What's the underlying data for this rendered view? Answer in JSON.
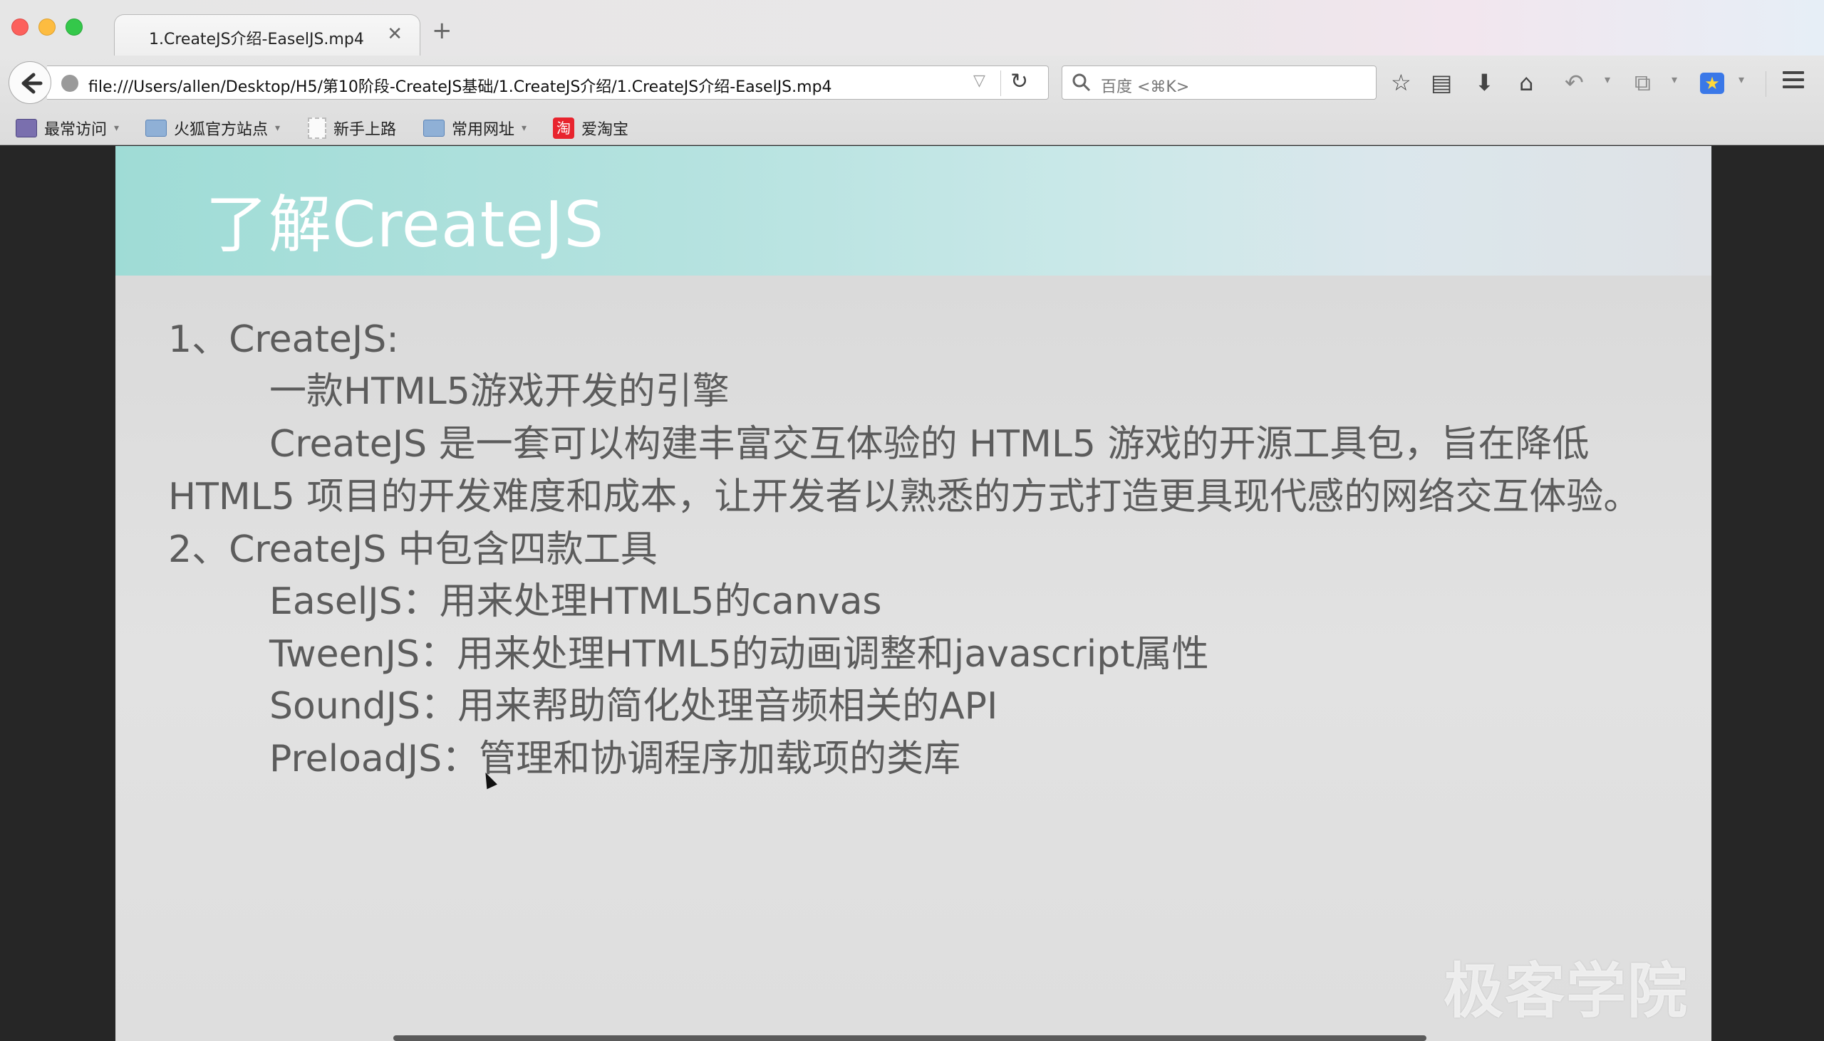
{
  "window": {
    "controls": [
      "close",
      "minimize",
      "maximize"
    ]
  },
  "tab": {
    "title": "1.CreateJS介绍-EaselJS.mp4",
    "close_glyph": "✕",
    "new_tab_glyph": "+"
  },
  "navbar": {
    "back_glyph": "🡐",
    "url": "file:///Users/allen/Desktop/H5/第10阶段-CreateJS基础/1.CreateJS介绍/1.CreateJS介绍-EaselJS.mp4",
    "url_drop_glyph": "▽",
    "reload_glyph": "↻",
    "search_placeholder": "百度 <⌘K>",
    "search_glyph": "⚲",
    "icons": {
      "bookmark_star": "☆",
      "reading_list": "▤",
      "download": "⬇",
      "home": "⌂",
      "undo": "↶",
      "crop": "⧉",
      "extension": "★"
    },
    "drop_glyph": "▾"
  },
  "bookmarks": [
    {
      "label": "最常访问",
      "icon": "visited-icon",
      "has_caret": true
    },
    {
      "label": "火狐官方站点",
      "icon": "folder-icon",
      "has_caret": true
    },
    {
      "label": "新手上路",
      "icon": "page-icon",
      "has_caret": false
    },
    {
      "label": "常用网址",
      "icon": "folder-icon",
      "has_caret": true
    },
    {
      "label": "爱淘宝",
      "icon": "taobao-icon",
      "has_caret": false,
      "icon_text": "淘"
    }
  ],
  "slide": {
    "title": "了解CreateJS",
    "lines": [
      "1、CreateJS:",
      "一款HTML5游戏开发的引擎",
      "CreateJS 是一套可以构建丰富交互体验的 HTML5 游戏的开源工具包，旨在降低",
      "HTML5 项目的开发难度和成本，让开发者以熟悉的方式打造更具现代感的网络交互体验。",
      "2、CreateJS 中包含四款工具",
      "EaselJS：用来处理HTML5的canvas",
      "TweenJS：用来处理HTML5的动画调整和javascript属性",
      "SoundJS：用来帮助简化处理音频相关的API",
      "PreloadJS：管理和协调程序加载项的类库"
    ],
    "watermark": "极客学院"
  },
  "colors": {
    "header_teal": "#9fdcd6",
    "slide_text": "#5c5c5c",
    "frame_dark": "#262626"
  }
}
